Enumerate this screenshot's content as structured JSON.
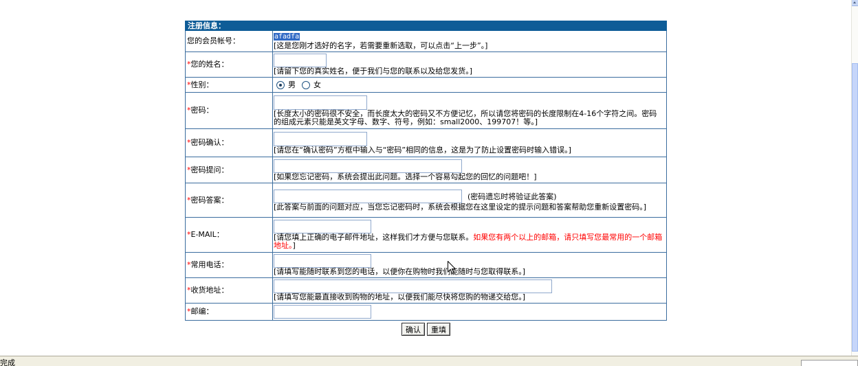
{
  "form": {
    "title": "注册信息：",
    "required_mark": "*"
  },
  "username": {
    "label": "您的会员帐号：",
    "value": "afadfa",
    "hint": "[这是您刚才选好的名字，若需要重新选取，可以点击“上一步”。]"
  },
  "realname": {
    "label": "您的姓名：",
    "value": "",
    "hint": "[请留下您的真实姓名，便于我们与您的联系以及给您发货。]"
  },
  "gender": {
    "label": "性别：",
    "options": [
      "男",
      "女"
    ],
    "selected": "男"
  },
  "password": {
    "label": "密码：",
    "value": "",
    "hint": "[长度太小的密码很不安全，而长度太大的密码又不方便记忆，所以请您将密码的长度限制在4-16个字符之间。密码的组成元素只能是英文字母、数字、符号，例如：small2000、199707！等。]"
  },
  "password_confirm": {
    "label": "密码确认：",
    "value": "",
    "hint": "[请您在“确认密码”方框中输入与“密码”相同的信息，这是为了防止设置密码时输入错误。]"
  },
  "question": {
    "label": "密码提问：",
    "value": "",
    "hint": "[如果您忘记密码，系统会提出此问题。选择一个容易勾起您的回忆的问题吧！]"
  },
  "answer": {
    "label": "密码答案：",
    "value": "",
    "note": "(密码遗忘时将验证此答案)",
    "hint": "[此答案与前面的问题对应，当您忘记密码时，系统会根据您在这里设定的提示问题和答案帮助您重新设置密码。]"
  },
  "email": {
    "label": "E-MAIL：",
    "value": "",
    "hint_prefix": "[请您填上正确的电子邮件地址，这样我们才方便与您联系。",
    "hint_warning": "如果您有两个以上的邮箱，请只填写您最常用的一个邮箱地址。",
    "hint_suffix": "]"
  },
  "phone": {
    "label": "常用电话：",
    "value": "",
    "hint": "[请填写能随时联系到您的电话，以便你在购物时我们能随时与您取得联系。]"
  },
  "address": {
    "label": "收货地址：",
    "value": "",
    "hint": "[请填写您能最直接收到购物的地址，以便我们能尽快将您购的物递交给您。]"
  },
  "postcode": {
    "label": "邮编：",
    "value": ""
  },
  "buttons": {
    "submit": "确认",
    "reset": "重填"
  },
  "status_bar": {
    "text": "完成"
  },
  "colors": {
    "header_bg": "#0e5c97",
    "border": "#3a6c9e",
    "required": "#ff0000",
    "warning": "#ff0000",
    "selection": "#316ac5"
  }
}
